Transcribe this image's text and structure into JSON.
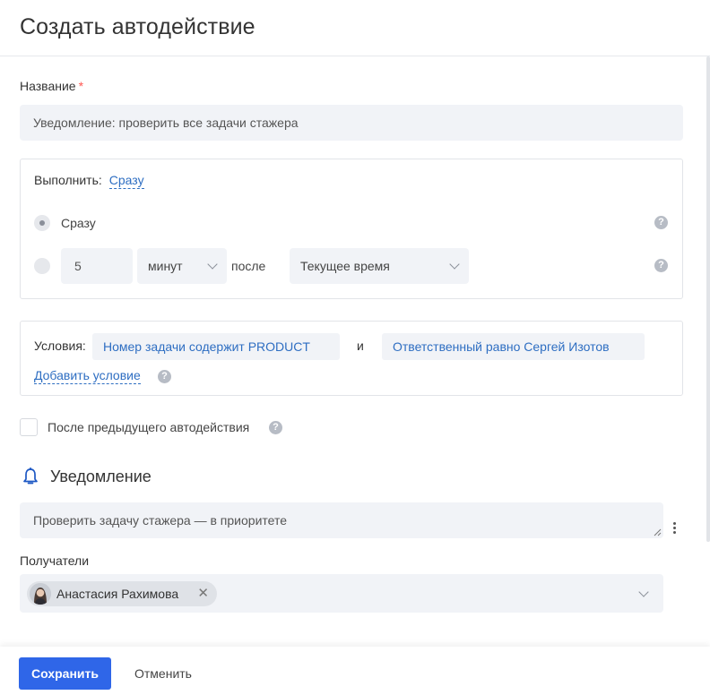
{
  "dialog": {
    "title": "Создать автодействие"
  },
  "name_field": {
    "label": "Название",
    "required_mark": "*",
    "value": "Уведомление: проверить все задачи стажера"
  },
  "execute": {
    "label": "Выполнить:",
    "current": "Сразу",
    "option_immediately": "Сразу",
    "delay_value": "5",
    "unit_selected": "минут",
    "after_label": "после",
    "reference_selected": "Текущее время",
    "help": "?"
  },
  "conditions": {
    "label": "Условия:",
    "items": [
      {
        "text": "Номер задачи содержит PRODUCT"
      },
      {
        "text": "Ответственный равно Сергей Изотов"
      }
    ],
    "joiner": "и",
    "add_label": "Добавить условие",
    "help": "?"
  },
  "after_previous": {
    "label": "После предыдущего автодействия",
    "checked": false,
    "help": "?"
  },
  "notification": {
    "title": "Уведомление",
    "message": "Проверить задачу стажера — в приоритете",
    "recipients_label": "Получатели",
    "recipients": [
      {
        "name": "Анастасия Рахимова"
      }
    ]
  },
  "footer": {
    "save_label": "Сохранить",
    "cancel_label": "Отменить"
  },
  "colors": {
    "primary": "#2f66e8",
    "link": "#2e6ec2",
    "field_bg": "#f1f3f7",
    "required": "#ff5752"
  }
}
